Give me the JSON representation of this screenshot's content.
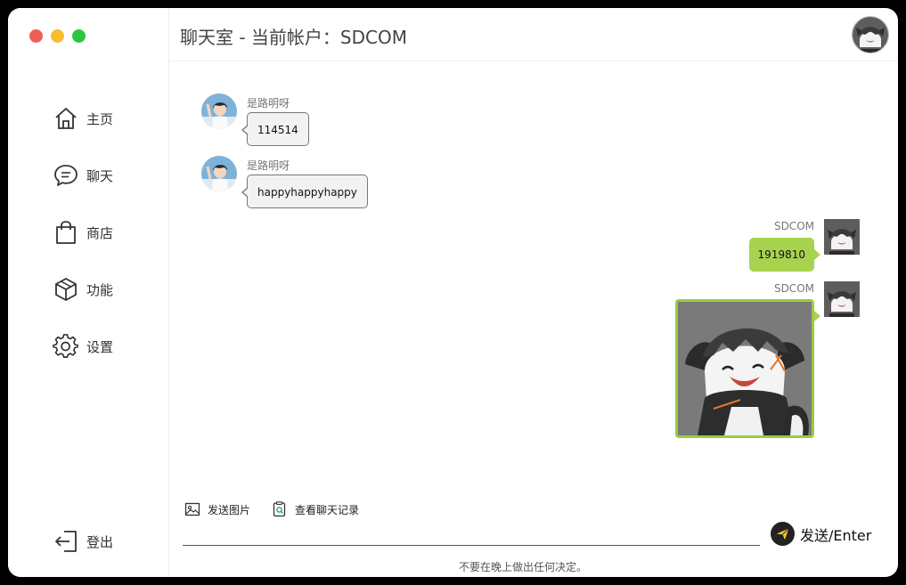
{
  "window": {
    "title": "聊天室 - 当前帐户：SDCOM"
  },
  "sidebar": {
    "items": [
      {
        "label": "主页",
        "icon": "home-icon"
      },
      {
        "label": "聊天",
        "icon": "chat-icon"
      },
      {
        "label": "商店",
        "icon": "shopping-bag-icon"
      },
      {
        "label": "功能",
        "icon": "cube-icon"
      },
      {
        "label": "设置",
        "icon": "gear-icon"
      }
    ],
    "logout_label": "登出"
  },
  "messages": [
    {
      "sender": "是路明呀",
      "text": "114514",
      "direction": "incoming"
    },
    {
      "sender": "是路明呀",
      "text": "happyhappyhappy",
      "direction": "incoming"
    },
    {
      "sender": "SDCOM",
      "text": "1919810",
      "direction": "outgoing"
    },
    {
      "sender": "SDCOM",
      "image": "wolf-sticker",
      "direction": "outgoing"
    }
  ],
  "toolbar": {
    "send_image_label": "发送图片",
    "history_label": "查看聊天记录"
  },
  "composer": {
    "value": "",
    "send_label": "发送/Enter"
  },
  "footer": {
    "motto": "不要在晚上做出任何决定。"
  },
  "colors": {
    "outgoing_bubble": "#a8d34f",
    "incoming_bubble": "#f2f2f2",
    "traffic_red": "#ec5f56",
    "traffic_yellow": "#f6be2f",
    "traffic_green": "#2ac840"
  }
}
